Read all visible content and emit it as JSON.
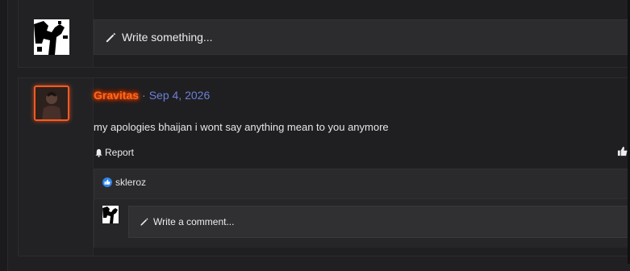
{
  "composer": {
    "placeholder": "Write something..."
  },
  "post": {
    "username": "Gravitas",
    "separator": "·",
    "date": "Sep 4, 2026",
    "body": "my apologies bhaijan i wont say anything mean to you anymore",
    "report_label": "Report",
    "like_more": "›"
  },
  "reactions": {
    "users": [
      {
        "name": "skleroz",
        "icon": "like-icon"
      }
    ]
  },
  "comment": {
    "placeholder": "Write a comment..."
  },
  "colors": {
    "username_glow": "#ff4500",
    "date": "#6d7fd6",
    "avatar_border": "#ff5a1f"
  }
}
